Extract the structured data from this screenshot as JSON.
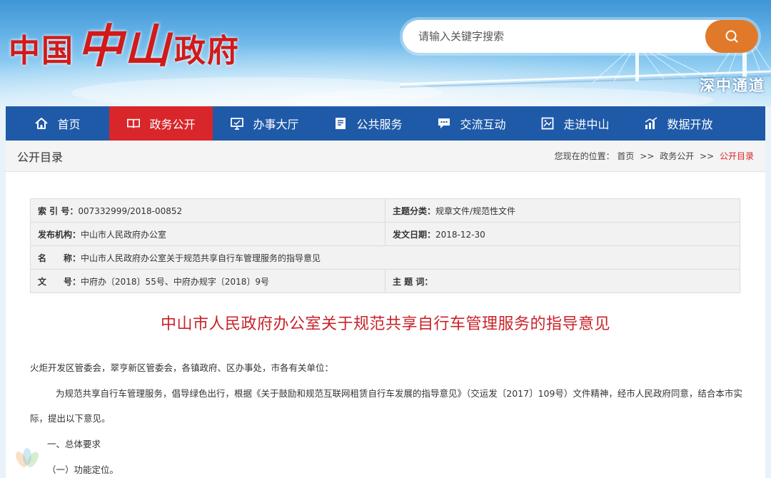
{
  "header": {
    "logo_part1": "中国",
    "logo_part2": "中山",
    "logo_part3": "政府",
    "search_placeholder": "请输入关键字搜索",
    "slogan": "深中通道"
  },
  "nav": {
    "items": [
      {
        "label": "首页",
        "icon": "home-icon"
      },
      {
        "label": "政务公开",
        "icon": "book-icon",
        "active": true
      },
      {
        "label": "办事大厅",
        "icon": "monitor-icon"
      },
      {
        "label": "公共服务",
        "icon": "document-icon"
      },
      {
        "label": "交流互动",
        "icon": "chat-icon"
      },
      {
        "label": "走进中山",
        "icon": "picture-icon"
      },
      {
        "label": "数据开放",
        "icon": "bar-chart-icon"
      }
    ]
  },
  "section": {
    "title": "公开目录",
    "breadcrumb_prefix": "您现在的位置：",
    "breadcrumb": [
      "首页",
      "政务公开",
      "公开目录"
    ],
    "separator": ">>"
  },
  "meta": {
    "index_label": "索 引 号：",
    "index_value": "007332999/2018-00852",
    "category_label": "主题分类：",
    "category_value": "规章文件/规范性文件",
    "publisher_label": "发布机构：",
    "publisher_value": "中山市人民政府办公室",
    "date_label": "发文日期：",
    "date_value": "2018-12-30",
    "name_label": "名　　称：",
    "name_value": "中山市人民政府办公室关于规范共享自行车管理服务的指导意见",
    "docno_label": "文　　号：",
    "docno_value": "中府办〔2018〕55号、中府办规字〔2018〕9号",
    "keywords_label": "主 题 词："
  },
  "document": {
    "title": "中山市人民政府办公室关于规范共享自行车管理服务的指导意见",
    "recipients": "火炬开发区管委会，翠亨新区管委会，各镇政府、区办事处，市各有关单位：",
    "para1_line1": "为规范共享自行车管理服务，倡导绿色出行，根据《关于鼓励和规范互联网租赁自行车发展的指导意见》（交运发〔2017〕109号）文件精神，经市人民政府同意，结合本市实",
    "para1_line2": "际，提出以下意见。",
    "section1": "一、总体要求",
    "section1_1": "（一）功能定位。"
  },
  "colors": {
    "nav_bg": "#1f5aa8",
    "nav_active": "#d9262b",
    "search_button": "#e07a2a",
    "title_red": "#c9222a"
  }
}
